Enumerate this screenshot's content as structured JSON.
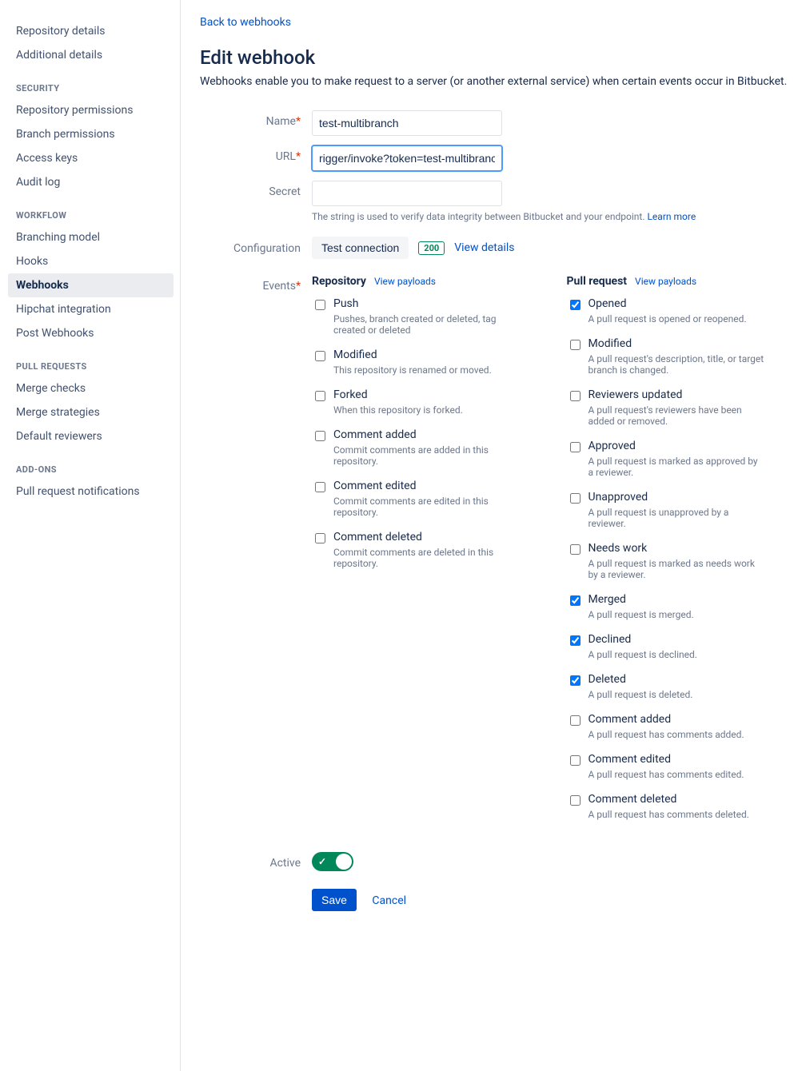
{
  "sidebar": {
    "top_items": [
      {
        "label": "Repository details",
        "key": "repo-details"
      },
      {
        "label": "Additional details",
        "key": "additional-details"
      }
    ],
    "groups": [
      {
        "heading": "SECURITY",
        "items": [
          {
            "label": "Repository permissions",
            "key": "repo-permissions"
          },
          {
            "label": "Branch permissions",
            "key": "branch-permissions"
          },
          {
            "label": "Access keys",
            "key": "access-keys"
          },
          {
            "label": "Audit log",
            "key": "audit-log"
          }
        ]
      },
      {
        "heading": "WORKFLOW",
        "items": [
          {
            "label": "Branching model",
            "key": "branching-model"
          },
          {
            "label": "Hooks",
            "key": "hooks"
          },
          {
            "label": "Webhooks",
            "key": "webhooks",
            "active": true
          },
          {
            "label": "Hipchat integration",
            "key": "hipchat"
          },
          {
            "label": "Post Webhooks",
            "key": "post-webhooks"
          }
        ]
      },
      {
        "heading": "PULL REQUESTS",
        "items": [
          {
            "label": "Merge checks",
            "key": "merge-checks"
          },
          {
            "label": "Merge strategies",
            "key": "merge-strategies"
          },
          {
            "label": "Default reviewers",
            "key": "default-reviewers"
          }
        ]
      },
      {
        "heading": "ADD-ONS",
        "items": [
          {
            "label": "Pull request notifications",
            "key": "pr-notifications"
          }
        ]
      }
    ]
  },
  "main": {
    "back_link": "Back to webhooks",
    "title": "Edit webhook",
    "description": "Webhooks enable you to make request to a server (or another external service) when certain events occur in Bitbucket.",
    "labels": {
      "name": "Name",
      "url": "URL",
      "secret": "Secret",
      "configuration": "Configuration",
      "events": "Events",
      "active": "Active"
    },
    "fields": {
      "name_value": "test-multibranch",
      "url_value": "rigger/invoke?token=test-multibranch",
      "secret_value": "",
      "secret_help": "The string is used to verify data integrity between Bitbucket and your endpoint.",
      "learn_more": "Learn more"
    },
    "configuration": {
      "test_button": "Test connection",
      "status_code": "200",
      "view_details": "View details"
    },
    "events": {
      "columns": [
        {
          "title": "Repository",
          "view_payloads": "View payloads",
          "items": [
            {
              "label": "Push",
              "desc": "Pushes, branch created or deleted, tag created or deleted",
              "checked": false
            },
            {
              "label": "Modified",
              "desc": "This repository is renamed or moved.",
              "checked": false
            },
            {
              "label": "Forked",
              "desc": "When this repository is forked.",
              "checked": false
            },
            {
              "label": "Comment added",
              "desc": "Commit comments are added in this repository.",
              "checked": false
            },
            {
              "label": "Comment edited",
              "desc": "Commit comments are edited in this repository.",
              "checked": false
            },
            {
              "label": "Comment deleted",
              "desc": "Commit comments are deleted in this repository.",
              "checked": false
            }
          ]
        },
        {
          "title": "Pull request",
          "view_payloads": "View payloads",
          "items": [
            {
              "label": "Opened",
              "desc": "A pull request is opened or reopened.",
              "checked": true
            },
            {
              "label": "Modified",
              "desc": "A pull request's description, title, or target branch is changed.",
              "checked": false
            },
            {
              "label": "Reviewers updated",
              "desc": "A pull request's reviewers have been added or removed.",
              "checked": false
            },
            {
              "label": "Approved",
              "desc": "A pull request is marked as approved by a reviewer.",
              "checked": false
            },
            {
              "label": "Unapproved",
              "desc": "A pull request is unapproved by a reviewer.",
              "checked": false
            },
            {
              "label": "Needs work",
              "desc": "A pull request is marked as needs work by a reviewer.",
              "checked": false
            },
            {
              "label": "Merged",
              "desc": "A pull request is merged.",
              "checked": true
            },
            {
              "label": "Declined",
              "desc": "A pull request is declined.",
              "checked": true
            },
            {
              "label": "Deleted",
              "desc": "A pull request is deleted.",
              "checked": true
            },
            {
              "label": "Comment added",
              "desc": "A pull request has comments added.",
              "checked": false
            },
            {
              "label": "Comment edited",
              "desc": "A pull request has comments edited.",
              "checked": false
            },
            {
              "label": "Comment deleted",
              "desc": "A pull request has comments deleted.",
              "checked": false
            }
          ]
        }
      ]
    },
    "active_value": true,
    "actions": {
      "save": "Save",
      "cancel": "Cancel"
    }
  }
}
